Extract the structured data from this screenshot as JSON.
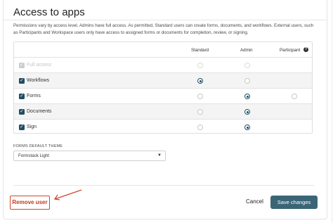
{
  "header": {
    "title": "Access to apps",
    "description": "Permissions vary by access level. Admins have full access. As permitted, Standard users can create forms, documents, and workflows. External users, such as Participants and Workspace users only have access to assigned forms or documents for completion, review, or signing."
  },
  "table": {
    "columns": [
      "Standard",
      "Admin",
      "Participant"
    ],
    "rows": [
      {
        "label": "Full access",
        "checked": true,
        "disabled": true,
        "standard": "empty",
        "admin": "empty",
        "participant": null
      },
      {
        "label": "Workflows",
        "checked": true,
        "disabled": false,
        "standard": "selected",
        "admin": "empty",
        "participant": null
      },
      {
        "label": "Forms",
        "checked": true,
        "disabled": false,
        "standard": "empty",
        "admin": "selected",
        "participant": "empty"
      },
      {
        "label": "Documents",
        "checked": true,
        "disabled": false,
        "standard": "empty",
        "admin": "selected",
        "participant": null
      },
      {
        "label": "Sign",
        "checked": true,
        "disabled": false,
        "standard": "empty",
        "admin": "selected",
        "participant": null
      }
    ]
  },
  "theme": {
    "label": "FORMS DEFAULT THEME",
    "value": "Formstack Light"
  },
  "footer": {
    "remove_label": "Remove user",
    "cancel_label": "Cancel",
    "save_label": "Save changes"
  },
  "colors": {
    "accent": "#1e4e64",
    "save_button": "#3a6577",
    "remove_highlight": "#d4462a"
  },
  "icons": {
    "checkbox": "check-icon",
    "help": "question-circle-icon",
    "dropdown": "caret-down-icon",
    "annotation": "arrow-icon"
  }
}
